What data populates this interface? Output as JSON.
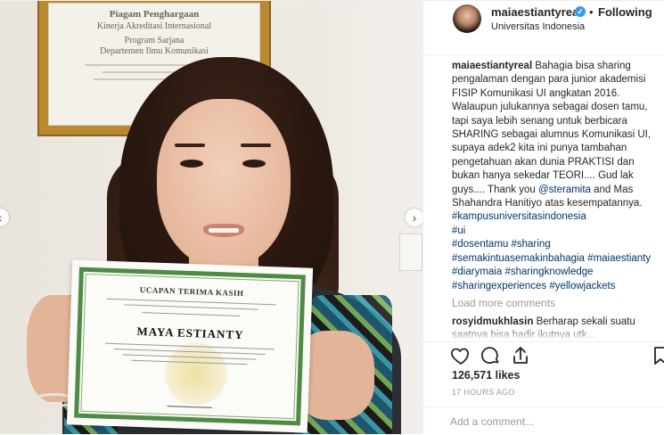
{
  "header": {
    "username": "maiaestiantyreal",
    "separator": "•",
    "follow_label": "Following",
    "location": "Universitas Indonesia"
  },
  "photo": {
    "frame_title": "Piagam Penghargaan",
    "frame_subtitle": "Kinerja Akreditasi Internasional",
    "frame_program": "Program Sarjana",
    "frame_department": "Departemen Ilmu Komunikasi",
    "certificate_title": "UCAPAN TERIMA KASIH",
    "certificate_name": "MAYA ESTIANTY"
  },
  "caption": {
    "user": "maiaestiantyreal",
    "text_1": "Bahagia bisa sharing pengalaman dengan para junior akademisi FISIP Komunikasi UI angkatan 2016. Walaupun julukannya sebagai dosen tamu, tapi saya lebih senang untuk berbicara SHARING sebagai alumnus Komunikasi UI, supaya adek2 kita ini punya tambahan pengetahuan akan dunia PRAKTISI dan bukan hanya sekedar TEORI.... Gud lak guys.... Thank you",
    "mention": "@steramita",
    "text_2": "and Mas Shahandra Hanitiyo atas kesempatannya.",
    "tags": [
      "#kampusuniversitasindonesia",
      "#ui",
      "#dosentamu",
      "#sharing",
      "#semakintuasemakinbahagia",
      "#maiaestianty",
      "#diarymaia",
      "#sharingknowledge",
      "#sharingexperiences",
      "#yellowjackets"
    ]
  },
  "load_more": "Load more comments",
  "comment": {
    "user": "rosyidmukhlasin",
    "text": "Berharap sekali suatu saatnya bisa hadir ikutnya utk..."
  },
  "actions": {
    "like_icon": "heart-icon",
    "comment_icon": "speech-bubble-icon",
    "share_icon": "share-icon",
    "save_icon": "bookmark-icon"
  },
  "likes": "126,571 likes",
  "time": "17 HOURS AGO",
  "add_comment_placeholder": "Add a comment..."
}
